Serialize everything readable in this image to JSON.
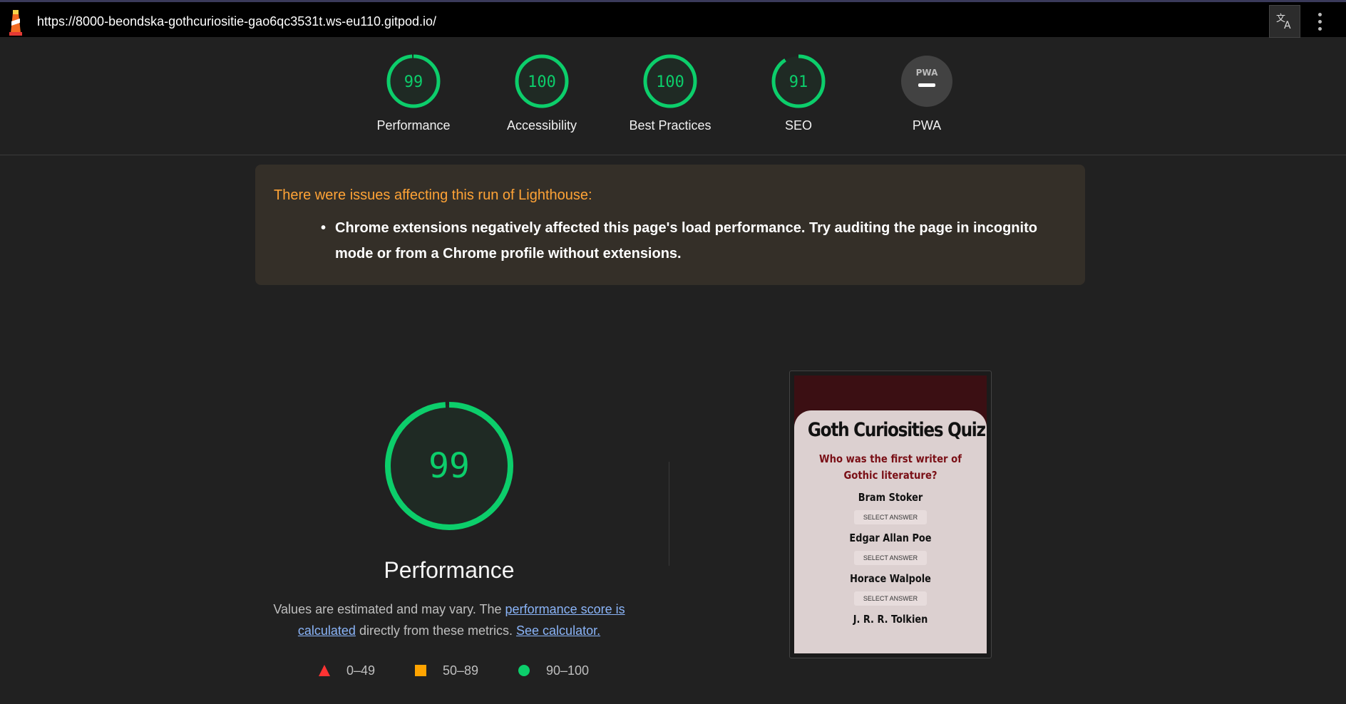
{
  "browser": {
    "url": "https://8000-beondska-gothcuriositie-gao6qc3531t.ws-eu110.gitpod.io/"
  },
  "colors": {
    "pass": "#0cce6b",
    "average": "#ffa400",
    "fail": "#ff3333",
    "warning_title": "#ffa336",
    "link": "#8ab4f8"
  },
  "scores": [
    {
      "label": "Performance",
      "value": "99",
      "score": 99
    },
    {
      "label": "Accessibility",
      "value": "100",
      "score": 100
    },
    {
      "label": "Best Practices",
      "value": "100",
      "score": 100
    },
    {
      "label": "SEO",
      "value": "91",
      "score": 91
    },
    {
      "label": "PWA",
      "value": "PWA",
      "score": null
    }
  ],
  "warning": {
    "title": "There were issues affecting this run of Lighthouse:",
    "items": [
      "Chrome extensions negatively affected this page's load performance. Try auditing the page in incognito mode or from a Chrome profile without extensions."
    ]
  },
  "performance": {
    "score": "99",
    "score_value": 99,
    "title": "Performance",
    "desc_prefix": "Values are estimated and may vary. The ",
    "desc_link1": "performance score is calculated",
    "desc_middle": " directly from these metrics. ",
    "desc_link2": "See calculator."
  },
  "legend": [
    {
      "shape": "triangle-icon",
      "label": "0–49"
    },
    {
      "shape": "square-icon",
      "label": "50–89"
    },
    {
      "shape": "circle-icon",
      "label": "90–100"
    }
  ],
  "thumbnail": {
    "title": "Goth Curiosities Quiz",
    "question": "Who was the first writer of Gothic literature?",
    "answers": [
      "Bram Stoker",
      "Edgar Allan Poe",
      "Horace Walpole",
      "J. R. R. Tolkien"
    ],
    "button_label": "SELECT ANSWER"
  }
}
